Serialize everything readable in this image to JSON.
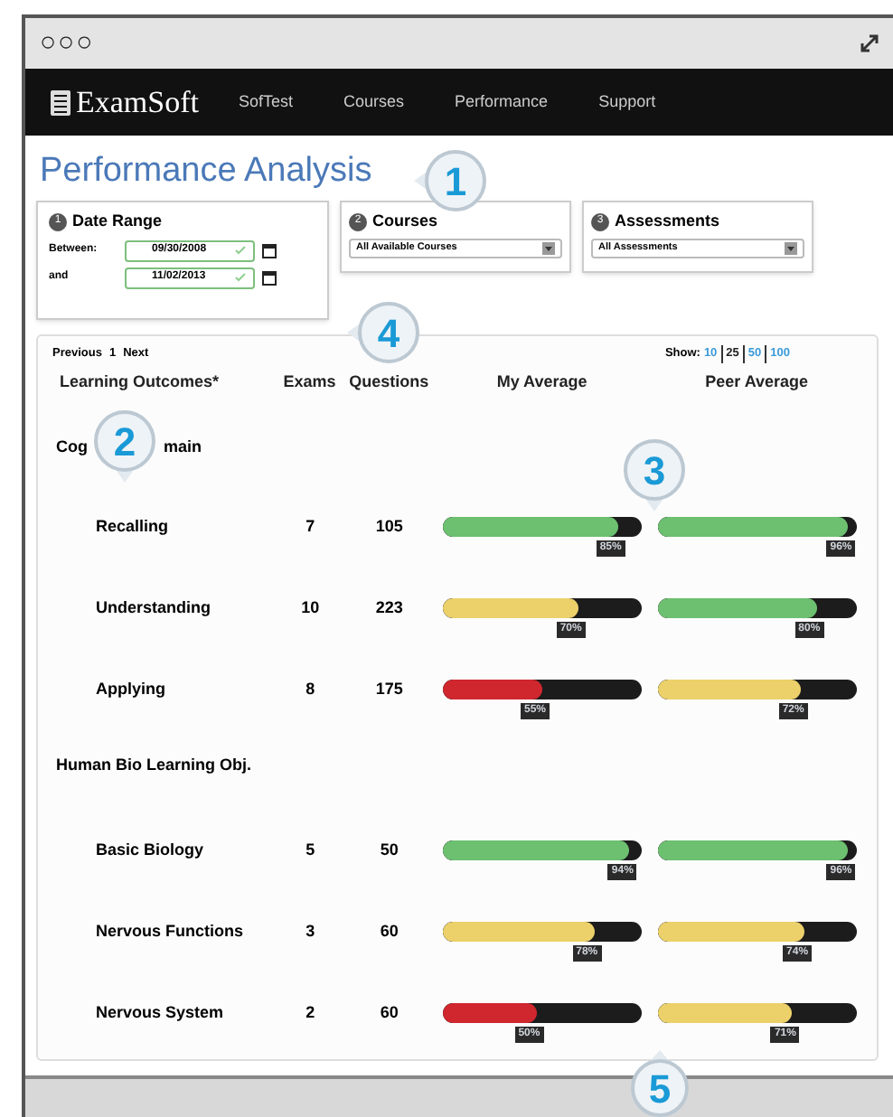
{
  "window": {
    "controls": "○○○"
  },
  "nav": {
    "brand": "ExamSoft",
    "items": [
      "SofTest",
      "Courses",
      "Performance",
      "Support"
    ]
  },
  "page_title": "Performance Analysis",
  "filters": {
    "date_range": {
      "step": "1",
      "title": "Date Range",
      "rows": [
        {
          "label": "Between:",
          "value": "09/30/2008"
        },
        {
          "label": "and",
          "value": "11/02/2013"
        }
      ]
    },
    "selects": [
      {
        "step": "2",
        "title": "Courses",
        "value": "All Available Courses"
      },
      {
        "step": "3",
        "title": "Assessments",
        "value": "All Assessments"
      }
    ]
  },
  "pager": {
    "previous": "Previous",
    "page": "1",
    "next": "Next",
    "show_label": "Show:",
    "sizes": [
      {
        "label": "10",
        "selected": false
      },
      {
        "label": "25",
        "selected": true
      },
      {
        "label": "50",
        "selected": false
      },
      {
        "label": "100",
        "selected": false
      }
    ]
  },
  "table": {
    "columns": [
      "Learning Outcomes*",
      "Exams",
      "Questions",
      "My Average",
      "Peer Average"
    ],
    "groups": [
      {
        "title_parts": [
          "Cog",
          "main"
        ],
        "rows": [
          {
            "name": "Recalling",
            "exams": "7",
            "questions": "105",
            "my": {
              "level": 0.88,
              "color": "#6cc070",
              "pct": "85%"
            },
            "peer": {
              "level": 0.96,
              "color": "#6cc070",
              "pct": "96%"
            }
          },
          {
            "name": "Understanding",
            "exams": "10",
            "questions": "223",
            "my": {
              "level": 0.68,
              "color": "#ecd06a",
              "pct": "70%"
            },
            "peer": {
              "level": 0.8,
              "color": "#6cc070",
              "pct": "80%"
            }
          },
          {
            "name": "Applying",
            "exams": "8",
            "questions": "175",
            "my": {
              "level": 0.5,
              "color": "#d0262e",
              "pct": "55%"
            },
            "peer": {
              "level": 0.72,
              "color": "#ecd06a",
              "pct": "72%"
            }
          }
        ]
      },
      {
        "title_parts": [
          "Human Bio Learning Obj."
        ],
        "rows": [
          {
            "name": "Basic Biology",
            "exams": "5",
            "questions": "50",
            "my": {
              "level": 0.94,
              "color": "#6cc070",
              "pct": "94%"
            },
            "peer": {
              "level": 0.96,
              "color": "#6cc070",
              "pct": "96%"
            }
          },
          {
            "name": "Nervous Functions",
            "exams": "3",
            "questions": "60",
            "my": {
              "level": 0.76,
              "color": "#ecd06a",
              "pct": "78%"
            },
            "peer": {
              "level": 0.74,
              "color": "#ecd06a",
              "pct": "74%"
            }
          },
          {
            "name": "Nervous System",
            "exams": "2",
            "questions": "60",
            "my": {
              "level": 0.47,
              "color": "#d0262e",
              "pct": "50%"
            },
            "peer": {
              "level": 0.68,
              "color": "#ecd06a",
              "pct": "71%"
            }
          }
        ]
      }
    ]
  },
  "callouts": [
    "1",
    "2",
    "3",
    "4",
    "5"
  ]
}
